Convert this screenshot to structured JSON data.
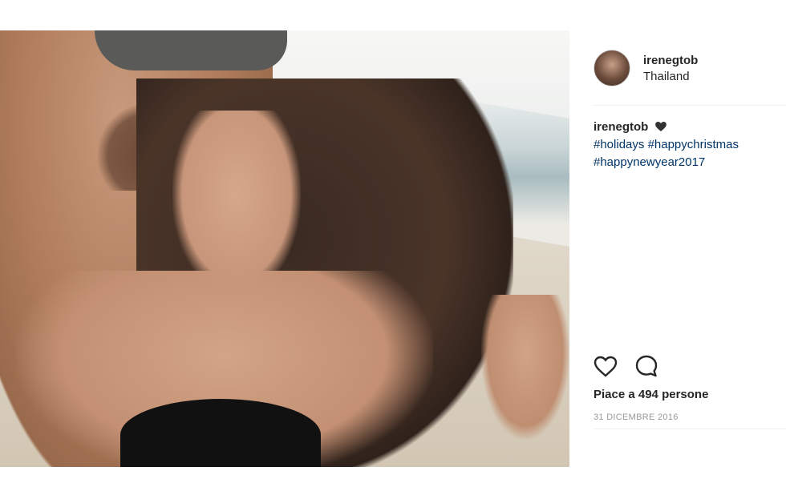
{
  "post": {
    "username": "irenegtob",
    "location": "Thailand",
    "caption_user": "irenegtob",
    "hashtags": [
      "#holidays",
      "#happychristmas",
      "#happynewyear2017"
    ],
    "likes_text": "Piace a 494 persone",
    "date": "31 DICEMBRE 2016"
  },
  "icons": {
    "like": "heart-outline-icon",
    "comment": "speech-bubble-icon",
    "caption_emoji": "black-heart-icon"
  },
  "colors": {
    "hashtag": "#003569",
    "text": "#262626",
    "date": "#999999"
  }
}
